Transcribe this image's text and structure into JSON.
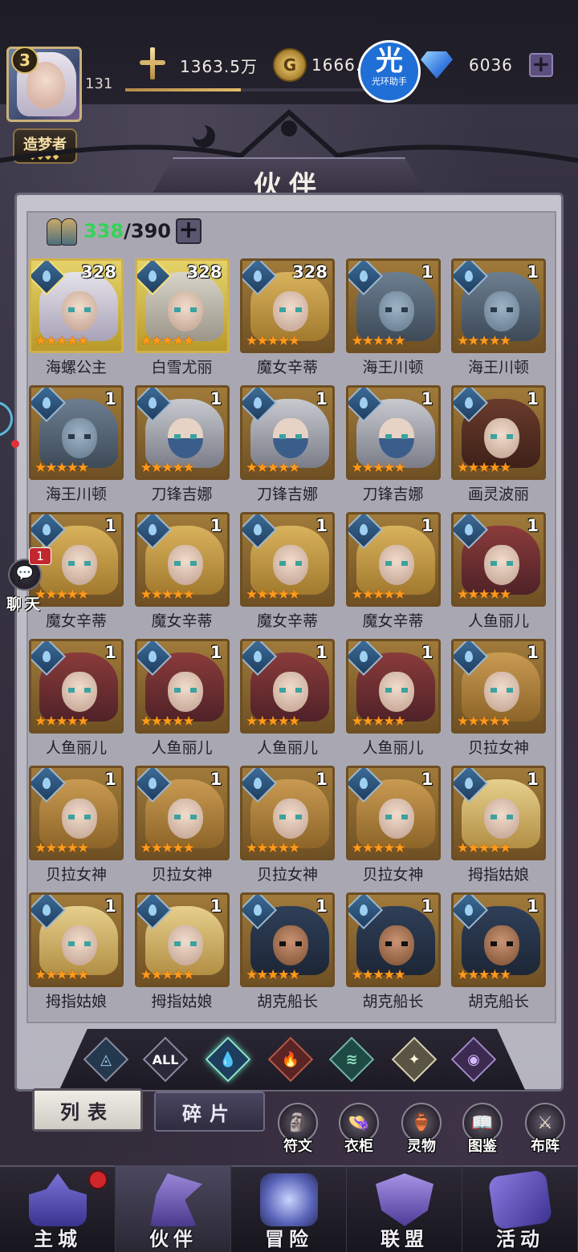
{
  "player": {
    "vip_level": "3",
    "level": "131",
    "title": "造梦者",
    "title_diamonds": "◆◆◆◆",
    "xp_fraction": 0.48
  },
  "resources": {
    "power": "1363.5万",
    "gold": "1666.5",
    "gems": "6036"
  },
  "helper": {
    "icon_text": "光",
    "label": "光环助手"
  },
  "page_title": "伙伴",
  "capacity": {
    "current": "338",
    "separator": "/",
    "max": "390"
  },
  "heroes": [
    {
      "name": "海螺公主",
      "level": "328",
      "stars": "★★★★★",
      "frame": "gold",
      "portrait": "conch"
    },
    {
      "name": "白雪尤丽",
      "level": "328",
      "stars": "★★★★★",
      "frame": "gold",
      "portrait": "snow"
    },
    {
      "name": "魔女辛蒂",
      "level": "328",
      "stars": "★★★★★",
      "frame": "bronze",
      "portrait": "witch"
    },
    {
      "name": "海王川顿",
      "level": "1",
      "stars": "★★★★★",
      "frame": "bronze",
      "portrait": "king"
    },
    {
      "name": "海王川顿",
      "level": "1",
      "stars": "★★★★★",
      "frame": "bronze",
      "portrait": "king"
    },
    {
      "name": "海王川顿",
      "level": "1",
      "stars": "★★★★★",
      "frame": "bronze",
      "portrait": "king"
    },
    {
      "name": "刀锋吉娜",
      "level": "1",
      "stars": "★★★★★",
      "frame": "bronze",
      "portrait": "blade"
    },
    {
      "name": "刀锋吉娜",
      "level": "1",
      "stars": "★★★★★",
      "frame": "bronze",
      "portrait": "blade"
    },
    {
      "name": "刀锋吉娜",
      "level": "1",
      "stars": "★★★★★",
      "frame": "bronze",
      "portrait": "blade"
    },
    {
      "name": "画灵波丽",
      "level": "1",
      "stars": "★★★★★",
      "frame": "bronze",
      "portrait": "paint"
    },
    {
      "name": "魔女辛蒂",
      "level": "1",
      "stars": "★★★★★",
      "frame": "bronze",
      "portrait": "witch"
    },
    {
      "name": "魔女辛蒂",
      "level": "1",
      "stars": "★★★★★",
      "frame": "bronze",
      "portrait": "witch"
    },
    {
      "name": "魔女辛蒂",
      "level": "1",
      "stars": "★★★★★",
      "frame": "bronze",
      "portrait": "witch"
    },
    {
      "name": "魔女辛蒂",
      "level": "1",
      "stars": "★★★★★",
      "frame": "bronze",
      "portrait": "witch"
    },
    {
      "name": "人鱼丽儿",
      "level": "1",
      "stars": "★★★★★",
      "frame": "bronze",
      "portrait": "mermaid"
    },
    {
      "name": "人鱼丽儿",
      "level": "1",
      "stars": "★★★★★",
      "frame": "bronze",
      "portrait": "mermaid"
    },
    {
      "name": "人鱼丽儿",
      "level": "1",
      "stars": "★★★★★",
      "frame": "bronze",
      "portrait": "mermaid"
    },
    {
      "name": "人鱼丽儿",
      "level": "1",
      "stars": "★★★★★",
      "frame": "bronze",
      "portrait": "mermaid"
    },
    {
      "name": "人鱼丽儿",
      "level": "1",
      "stars": "★★★★★",
      "frame": "bronze",
      "portrait": "mermaid"
    },
    {
      "name": "贝拉女神",
      "level": "1",
      "stars": "★★★★★",
      "frame": "bronze",
      "portrait": "bella"
    },
    {
      "name": "贝拉女神",
      "level": "1",
      "stars": "★★★★★",
      "frame": "bronze",
      "portrait": "bella"
    },
    {
      "name": "贝拉女神",
      "level": "1",
      "stars": "★★★★★",
      "frame": "bronze",
      "portrait": "bella"
    },
    {
      "name": "贝拉女神",
      "level": "1",
      "stars": "★★★★★",
      "frame": "bronze",
      "portrait": "bella"
    },
    {
      "name": "贝拉女神",
      "level": "1",
      "stars": "★★★★★",
      "frame": "bronze",
      "portrait": "bella"
    },
    {
      "name": "拇指姑娘",
      "level": "1",
      "stars": "★★★★★",
      "frame": "bronze",
      "portrait": "thumb"
    },
    {
      "name": "拇指姑娘",
      "level": "1",
      "stars": "★★★★★",
      "frame": "bronze",
      "portrait": "thumb"
    },
    {
      "name": "拇指姑娘",
      "level": "1",
      "stars": "★★★★★",
      "frame": "bronze",
      "portrait": "thumb"
    },
    {
      "name": "胡克船长",
      "level": "1",
      "stars": "★★★★★",
      "frame": "bronze",
      "portrait": "hook"
    },
    {
      "name": "胡克船长",
      "level": "1",
      "stars": "★★★★★",
      "frame": "bronze",
      "portrait": "hook"
    },
    {
      "name": "胡克船长",
      "level": "1",
      "stars": "★★★★★",
      "frame": "bronze",
      "portrait": "hook"
    }
  ],
  "filters": [
    {
      "name": "ice-element-filter",
      "glyph": "◬",
      "cls": "f-ice"
    },
    {
      "name": "all-element-filter",
      "glyph": "ALL",
      "cls": "f-all"
    },
    {
      "name": "water-element-filter",
      "glyph": "💧",
      "cls": "f-water active"
    },
    {
      "name": "fire-element-filter",
      "glyph": "🔥",
      "cls": "f-fire"
    },
    {
      "name": "wind-element-filter",
      "glyph": "≋",
      "cls": "f-wind"
    },
    {
      "name": "light-element-filter",
      "glyph": "✦",
      "cls": "f-light"
    },
    {
      "name": "dark-element-filter",
      "glyph": "◉",
      "cls": "f-dark"
    }
  ],
  "tabs": {
    "list": "列表",
    "fragments": "碎片"
  },
  "functions": [
    {
      "label": "符文",
      "icon": "🗿"
    },
    {
      "label": "衣柜",
      "icon": "👒"
    },
    {
      "label": "灵物",
      "icon": "🏺"
    },
    {
      "label": "图鉴",
      "icon": "📖"
    },
    {
      "label": "布阵",
      "icon": "⚔"
    }
  ],
  "chat": {
    "label": "聊天",
    "badge": "1",
    "icon": "💬"
  },
  "nav": [
    {
      "label": "主城",
      "icon_class": "ic-city",
      "active": false
    },
    {
      "label": "伙伴",
      "icon_class": "ic-partner",
      "active": true
    },
    {
      "label": "冒险",
      "icon_class": "ic-adv",
      "active": false
    },
    {
      "label": "联盟",
      "icon_class": "ic-union",
      "active": false
    },
    {
      "label": "活动",
      "icon_class": "ic-act",
      "active": false
    }
  ],
  "colors": {
    "capacity_current": "#35d257",
    "active_filter_glow": "#5fd3b0",
    "star_orange": "#ff9a1a",
    "gold_frame": "#d2b14a",
    "bronze_frame": "#6d4e22"
  }
}
